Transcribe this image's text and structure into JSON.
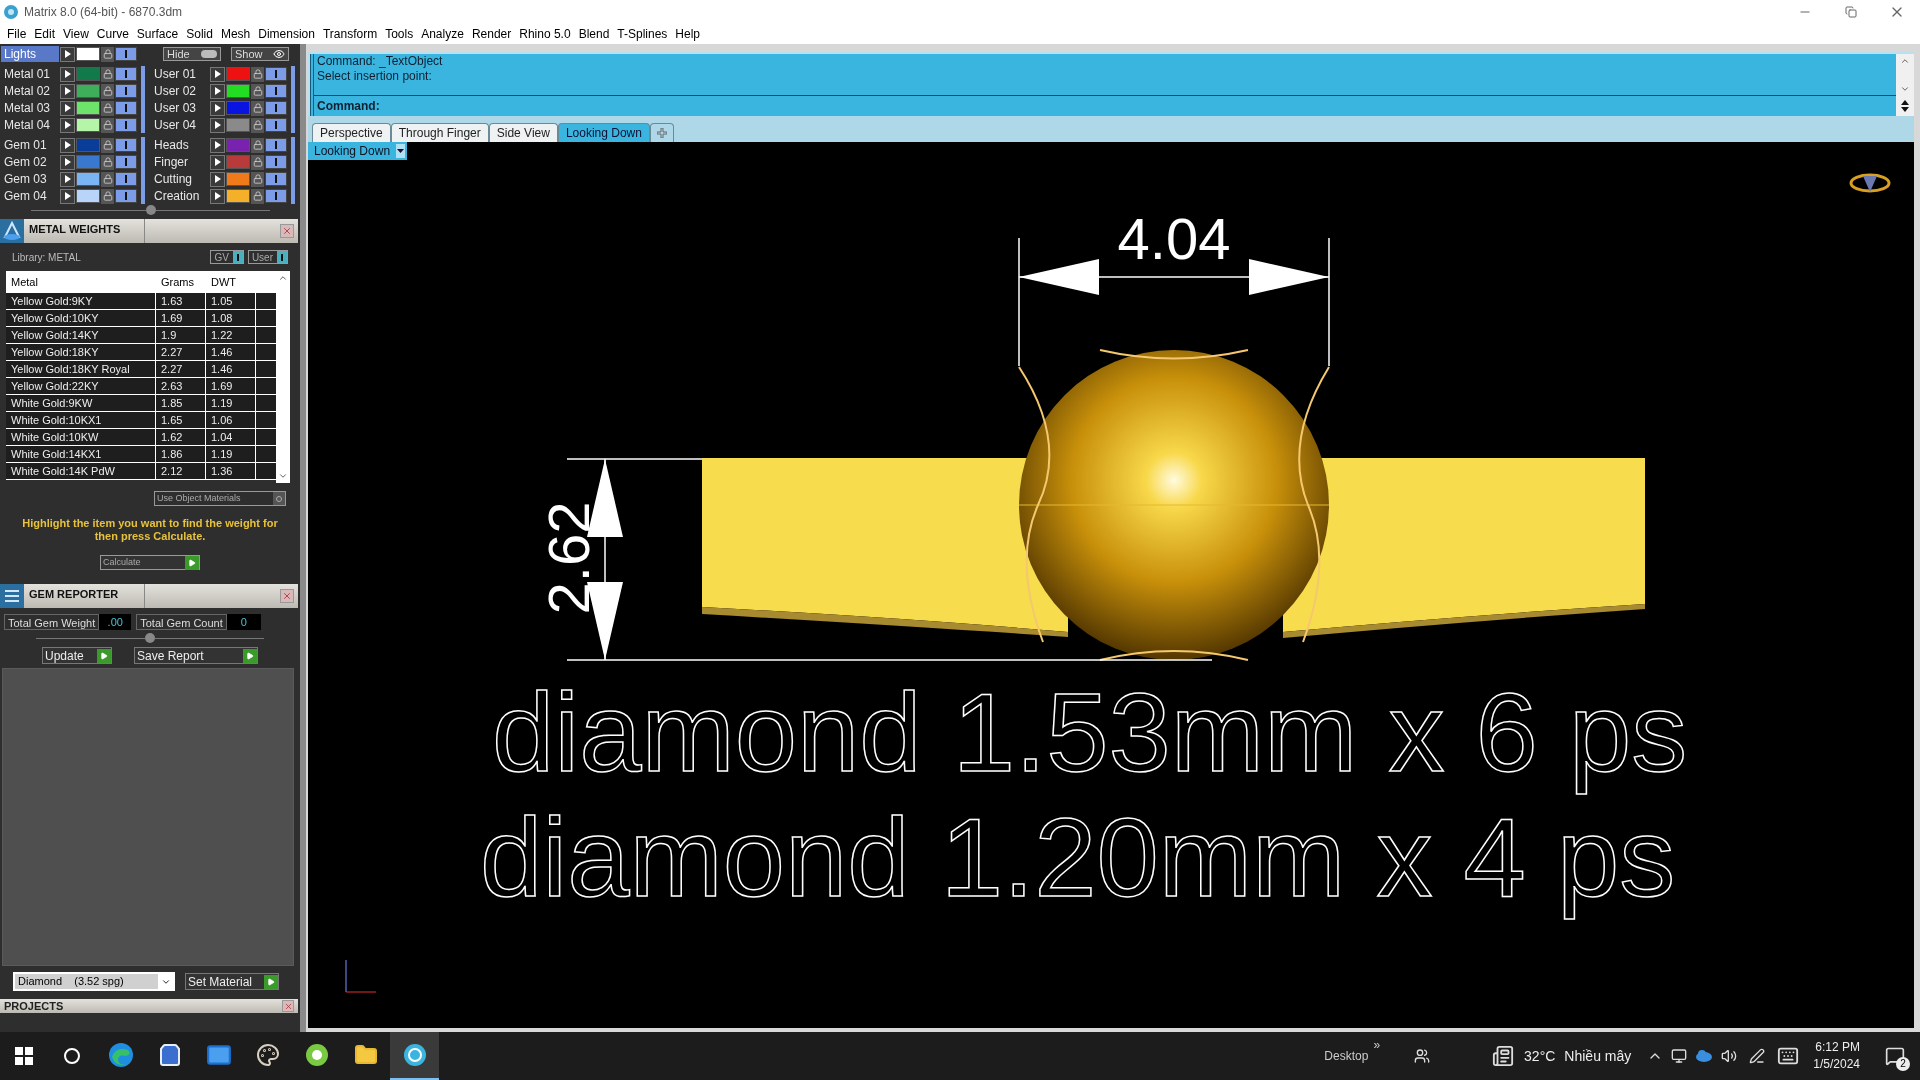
{
  "window": {
    "title": "Matrix 8.0 (64-bit) - 6870.3dm"
  },
  "menu": [
    "File",
    "Edit",
    "View",
    "Curve",
    "Surface",
    "Solid",
    "Mesh",
    "Dimension",
    "Transform",
    "Tools",
    "Analyze",
    "Render",
    "Rhino 5.0",
    "Blend",
    "T-Splines",
    "Help"
  ],
  "layers": {
    "lights": {
      "name": "Lights",
      "color": "#ffffff",
      "selected": true,
      "visible": true
    },
    "hide_button": "Hide",
    "show_button": "Show",
    "groups": [
      [
        {
          "left": {
            "name": "Metal 01",
            "color": "#127a4a",
            "selected": false,
            "visible": true
          },
          "right": {
            "name": "User 01",
            "color": "#ee1111",
            "selected": false,
            "visible": true
          }
        },
        {
          "left": {
            "name": "Metal 02",
            "color": "#3fae5a",
            "selected": false,
            "visible": true
          },
          "right": {
            "name": "User 02",
            "color": "#22dd22",
            "selected": false,
            "visible": true
          }
        },
        {
          "left": {
            "name": "Metal 03",
            "color": "#6ee36a",
            "selected": false,
            "visible": true
          },
          "right": {
            "name": "User 03",
            "color": "#0a14e0",
            "selected": false,
            "visible": true
          }
        },
        {
          "left": {
            "name": "Metal 04",
            "color": "#b4f5a8",
            "selected": false,
            "visible": true
          },
          "right": {
            "name": "User 04",
            "color": "#8a8a8a",
            "selected": false,
            "visible": true
          }
        }
      ],
      [
        {
          "left": {
            "name": "Gem 01",
            "color": "#0a3c9a",
            "selected": false,
            "visible": true
          },
          "right": {
            "name": "Heads",
            "color": "#7a22b0",
            "selected": false,
            "visible": true
          }
        },
        {
          "left": {
            "name": "Gem 02",
            "color": "#3a78d0",
            "selected": false,
            "visible": true
          },
          "right": {
            "name": "Finger",
            "color": "#b83a3a",
            "selected": false,
            "visible": true
          }
        },
        {
          "left": {
            "name": "Gem 03",
            "color": "#7ab4f5",
            "selected": false,
            "visible": true
          },
          "right": {
            "name": "Cutting",
            "color": "#f07a1a",
            "selected": false,
            "visible": true
          }
        },
        {
          "left": {
            "name": "Gem 04",
            "color": "#b8d4f8",
            "selected": false,
            "visible": true
          },
          "right": {
            "name": "Creation",
            "color": "#f5b02a",
            "selected": false,
            "visible": true
          }
        }
      ]
    ]
  },
  "metal_weights": {
    "title": "METAL WEIGHTS",
    "library": "Library: METAL",
    "toggles": [
      "GV",
      "User"
    ],
    "columns": [
      "Metal",
      "Grams",
      "DWT"
    ],
    "rows": [
      [
        "Yellow Gold:9KY",
        "1.63",
        "1.05"
      ],
      [
        "Yellow Gold:10KY",
        "1.69",
        "1.08"
      ],
      [
        "Yellow Gold:14KY",
        "1.9",
        "1.22"
      ],
      [
        "Yellow Gold:18KY",
        "2.27",
        "1.46"
      ],
      [
        "Yellow Gold:18KY Royal",
        "2.27",
        "1.46"
      ],
      [
        "Yellow Gold:22KY",
        "2.63",
        "1.69"
      ],
      [
        "White Gold:9KW",
        "1.85",
        "1.19"
      ],
      [
        "White Gold:10KX1",
        "1.65",
        "1.06"
      ],
      [
        "White Gold:10KW",
        "1.62",
        "1.04"
      ],
      [
        "White Gold:14KX1",
        "1.86",
        "1.19"
      ],
      [
        "White Gold:14K PdW",
        "2.12",
        "1.36"
      ]
    ],
    "use_object_materials": "Use Object Materials",
    "hint": "Highlight the item you want to find the weight for then press Calculate.",
    "calculate_button": "Calculate"
  },
  "gem_reporter": {
    "title": "GEM REPORTER",
    "total_weight_label": "Total Gem Weight",
    "total_weight": ".00",
    "total_count_label": "Total Gem Count",
    "total_count": "0",
    "update_button": "Update",
    "save_button": "Save Report",
    "material": "Diamond    (3.52 spg)",
    "set_material_button": "Set Material"
  },
  "projects": {
    "title": "PROJECTS"
  },
  "command": {
    "history": [
      "Command: _TextObject",
      "Select insertion point:"
    ],
    "prompt": "Command:"
  },
  "view_tabs": [
    {
      "label": "Perspective",
      "selected": false
    },
    {
      "label": "Through Finger",
      "selected": false
    },
    {
      "label": "Side View",
      "selected": false
    },
    {
      "label": "Looking Down",
      "selected": true
    }
  ],
  "viewport": {
    "label": "Looking Down",
    "width_dimension": "4.04",
    "height_dimension": "2.62",
    "texts": [
      "diamond 1.53mm x 6 ps",
      "diamond 1.20mm x 4 ps"
    ]
  },
  "taskbar": {
    "apps": [
      {
        "kind": "edge",
        "selected": false
      },
      {
        "kind": "store",
        "selected": false
      },
      {
        "kind": "mail",
        "selected": false
      },
      {
        "kind": "paint",
        "selected": false
      },
      {
        "kind": "green",
        "selected": false
      },
      {
        "kind": "folder",
        "selected": false
      },
      {
        "kind": "matrix",
        "selected": true
      }
    ],
    "desktop": "Desktop",
    "chevron": "»",
    "temperature": "32°C",
    "weather": "Nhiều mây",
    "time": "6:12 PM",
    "date": "1/5/2024",
    "notifications": "2"
  }
}
